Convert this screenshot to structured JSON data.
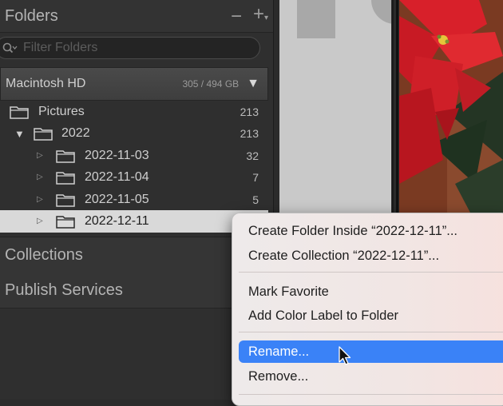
{
  "folders_panel": {
    "title": "Folders",
    "actions": {
      "remove": "−",
      "add": "+",
      "add_caret": "▾"
    },
    "filter": {
      "placeholder": "Filter Folders",
      "value": ""
    },
    "volume": {
      "name": "Macintosh HD",
      "usage": "305 / 494 GB",
      "toggle": "▼"
    },
    "rows": [
      {
        "name": "Pictures",
        "count": "213",
        "expanded": null
      },
      {
        "name": "2022",
        "count": "213",
        "expanded": true
      },
      {
        "name": "2022-11-03",
        "count": "32",
        "expanded": false
      },
      {
        "name": "2022-11-04",
        "count": "7",
        "expanded": false
      },
      {
        "name": "2022-11-05",
        "count": "5",
        "expanded": false
      },
      {
        "name": "2022-12-11",
        "count": "",
        "expanded": false,
        "selected": true
      }
    ]
  },
  "collections_panel": {
    "title": "Collections"
  },
  "publish_panel": {
    "title": "Publish Services"
  },
  "context_menu": {
    "items": [
      {
        "label": "Create Folder Inside “2022-12-11”...",
        "highlighted": false
      },
      {
        "label": "Create Collection “2022-12-11”...",
        "highlighted": false
      },
      {
        "label": "Mark Favorite",
        "highlighted": false
      },
      {
        "label": "Add Color Label to Folder",
        "highlighted": false
      },
      {
        "label": "Rename...",
        "highlighted": true
      },
      {
        "label": "Remove...",
        "highlighted": false
      }
    ]
  },
  "colors": {
    "panel_bg": "#2f2f2f",
    "selected_row": "#d9d9d9",
    "menu_highlight": "#3a82f7",
    "text_light": "#cfcfcf"
  },
  "icons": [
    "search-icon",
    "folder-icon",
    "disclosure-triangle-icon",
    "pointer-cursor-icon"
  ]
}
